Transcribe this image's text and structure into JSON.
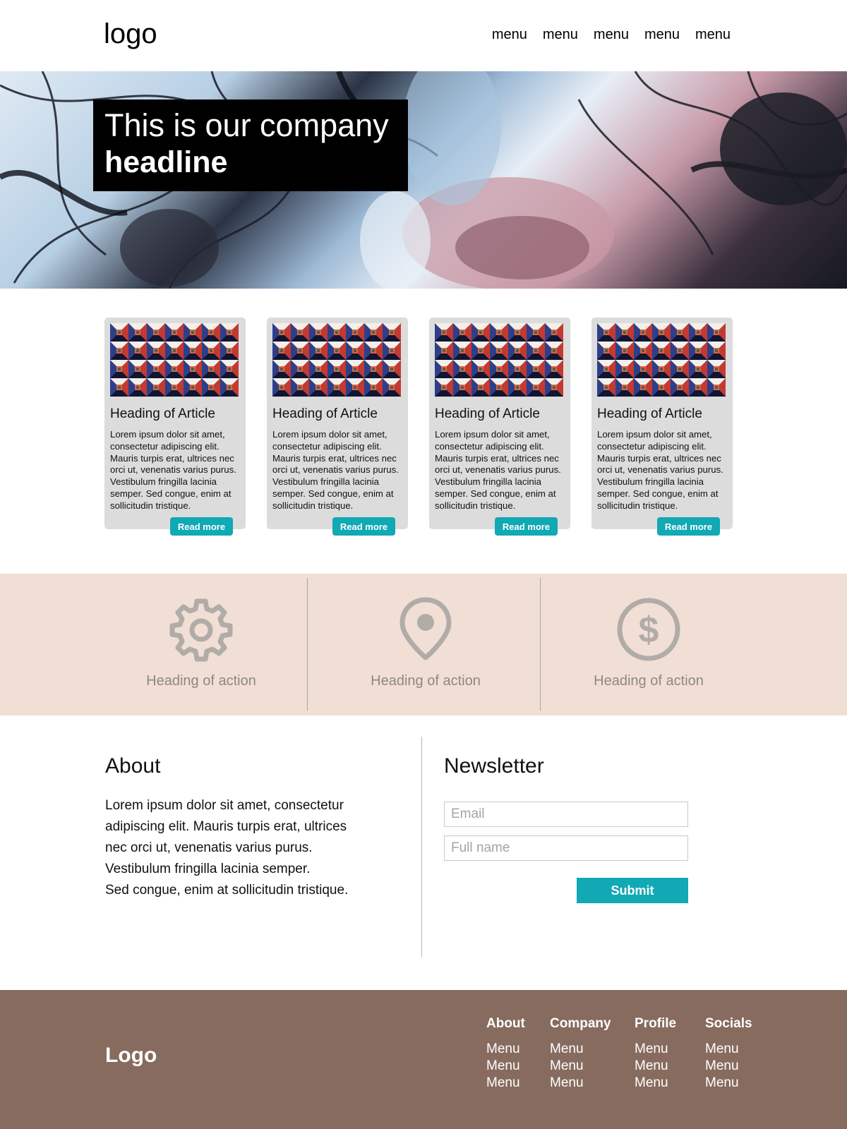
{
  "header": {
    "logo": "logo",
    "nav": [
      "menu",
      "menu",
      "menu",
      "menu",
      "menu"
    ]
  },
  "hero": {
    "headline_light": "This is our company",
    "headline_bold": "headline"
  },
  "articles": [
    {
      "title": "Heading of Article",
      "text": "Lorem ipsum dolor sit amet, consectetur adipiscing elit. Mauris turpis erat, ultrices nec orci ut, venenatis varius purus. Vestibulum fringilla lacinia semper. Sed congue, enim at sollicitudin tristique.",
      "button": "Read more"
    },
    {
      "title": "Heading of Article",
      "text": "Lorem ipsum dolor sit amet, consectetur adipiscing elit. Mauris turpis erat, ultrices nec orci ut, venenatis varius purus. Vestibulum fringilla lacinia semper. Sed congue, enim at sollicitudin tristique.",
      "button": "Read more"
    },
    {
      "title": "Heading of Article",
      "text": "Lorem ipsum dolor sit amet, consectetur adipiscing elit. Mauris turpis erat, ultrices nec orci ut, venenatis varius purus. Vestibulum fringilla lacinia semper. Sed congue, enim at sollicitudin tristique.",
      "button": "Read more"
    },
    {
      "title": "Heading of Article",
      "text": "Lorem ipsum dolor sit amet, consectetur adipiscing elit. Mauris turpis erat, ultrices nec orci ut, venenatis varius purus. Vestibulum fringilla lacinia semper. Sed congue, enim at sollicitudin tristique.",
      "button": "Read more"
    }
  ],
  "actions": [
    {
      "icon": "gear-icon",
      "label": "Heading of action"
    },
    {
      "icon": "map-pin-icon",
      "label": "Heading of action"
    },
    {
      "icon": "dollar-circle-icon",
      "label": "Heading of action"
    }
  ],
  "about": {
    "title": "About",
    "lines": [
      "Lorem ipsum dolor sit amet, consectetur",
      "adipiscing elit. Mauris turpis erat, ultrices",
      "nec orci ut, venenatis varius purus.",
      "Vestibulum fringilla lacinia semper.",
      "Sed congue, enim at sollicitudin tristique."
    ]
  },
  "newsletter": {
    "title": "Newsletter",
    "email_placeholder": "Email",
    "name_placeholder": "Full name",
    "submit": "Submit"
  },
  "footer": {
    "logo": "Logo",
    "columns": [
      {
        "heading": "About",
        "items": [
          "Menu",
          "Menu",
          "Menu"
        ]
      },
      {
        "heading": "Company",
        "items": [
          "Menu",
          "Menu",
          "Menu"
        ]
      },
      {
        "heading": "Profile",
        "items": [
          "Menu",
          "Menu",
          "Menu"
        ]
      },
      {
        "heading": "Socials",
        "items": [
          "Menu",
          "Menu",
          "Menu"
        ]
      }
    ]
  },
  "colors": {
    "accent": "#10a9b4",
    "actions_bg": "#f1dfd6",
    "footer_bg": "#876b5e",
    "card_bg": "#dcdcdc"
  }
}
